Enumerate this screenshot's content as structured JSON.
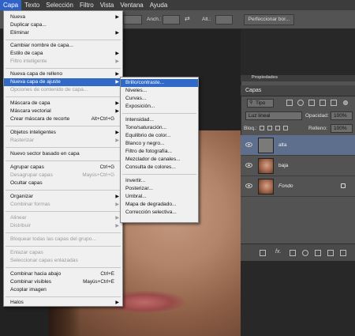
{
  "menubar": {
    "items": [
      "Capa",
      "Texto",
      "Selección",
      "Filtro",
      "Vista",
      "Ventana",
      "Ayuda"
    ],
    "active_index": 0
  },
  "options_bar": {
    "width_label": "Anch.:",
    "height_label": "Alt.:",
    "refine_button": "Perfeccionar bor..."
  },
  "capa_menu": {
    "items": [
      {
        "label": "Nueva",
        "shortcut": "",
        "submenu": true,
        "disabled": false
      },
      {
        "label": "Duplicar capa...",
        "shortcut": "",
        "submenu": false,
        "disabled": false
      },
      {
        "label": "Eliminar",
        "shortcut": "",
        "submenu": true,
        "disabled": false
      },
      {
        "label": "Cambiar nombre de capa...",
        "shortcut": "",
        "submenu": false,
        "disabled": false
      },
      {
        "label": "Estilo de capa",
        "shortcut": "",
        "submenu": true,
        "disabled": false
      },
      {
        "label": "Filtro inteligente",
        "shortcut": "",
        "submenu": true,
        "disabled": true
      },
      {
        "label": "Nueva capa de relleno",
        "shortcut": "",
        "submenu": true,
        "disabled": false
      },
      {
        "label": "Nueva capa de ajuste",
        "shortcut": "",
        "submenu": true,
        "disabled": false,
        "highlighted": true
      },
      {
        "label": "Opciones de contenido de capa...",
        "shortcut": "",
        "submenu": false,
        "disabled": true
      },
      {
        "label": "Máscara de capa",
        "shortcut": "",
        "submenu": true,
        "disabled": false
      },
      {
        "label": "Máscara vectorial",
        "shortcut": "",
        "submenu": true,
        "disabled": false
      },
      {
        "label": "Crear máscara de recorte",
        "shortcut": "Alt+Ctrl+G",
        "submenu": false,
        "disabled": false
      },
      {
        "label": "Objetos inteligentes",
        "shortcut": "",
        "submenu": true,
        "disabled": false
      },
      {
        "label": "Rasterizar",
        "shortcut": "",
        "submenu": true,
        "disabled": true
      },
      {
        "label": "Nuevo sector basado en capa",
        "shortcut": "",
        "submenu": false,
        "disabled": false
      },
      {
        "label": "Agrupar capas",
        "shortcut": "Ctrl+G",
        "submenu": false,
        "disabled": false
      },
      {
        "label": "Desagrupar capas",
        "shortcut": "Mayús+Ctrl+G",
        "submenu": false,
        "disabled": true
      },
      {
        "label": "Ocultar capas",
        "shortcut": "",
        "submenu": false,
        "disabled": false
      },
      {
        "label": "Organizar",
        "shortcut": "",
        "submenu": true,
        "disabled": false
      },
      {
        "label": "Combinar formas",
        "shortcut": "",
        "submenu": true,
        "disabled": true
      },
      {
        "label": "Alinear",
        "shortcut": "",
        "submenu": true,
        "disabled": true
      },
      {
        "label": "Distribuir",
        "shortcut": "",
        "submenu": true,
        "disabled": true
      },
      {
        "label": "Bloquear todas las capas del grupo...",
        "shortcut": "",
        "submenu": false,
        "disabled": true
      },
      {
        "label": "Enlazar capas",
        "shortcut": "",
        "submenu": false,
        "disabled": true
      },
      {
        "label": "Seleccionar capas enlazadas",
        "shortcut": "",
        "submenu": false,
        "disabled": true
      },
      {
        "label": "Combinar hacia abajo",
        "shortcut": "Ctrl+E",
        "submenu": false,
        "disabled": false
      },
      {
        "label": "Combinar visibles",
        "shortcut": "Mayús+Ctrl+E",
        "submenu": false,
        "disabled": false
      },
      {
        "label": "Acoplar imagen",
        "shortcut": "",
        "submenu": false,
        "disabled": false
      },
      {
        "label": "Halos",
        "shortcut": "",
        "submenu": true,
        "disabled": false
      }
    ]
  },
  "adjustment_submenu": {
    "items": [
      "Brillo/contraste...",
      "Niveles...",
      "Curvas...",
      "Exposición...",
      "Intensidad...",
      "Tono/saturación...",
      "Equilibrio de color...",
      "Blanco y negro...",
      "Filtro de fotografía...",
      "Mezclador de canales...",
      "Consulta de colores...",
      "Invertir...",
      "Posterizar...",
      "Umbral...",
      "Mapa de degradado...",
      "Corrección selectiva..."
    ],
    "highlighted_index": 0
  },
  "layers_panel": {
    "tab_strip_label": "Propiedades",
    "title": "Capas",
    "filter_label": "Tipo",
    "blend_mode": "Luz lineal",
    "opacity_label": "Opacidad:",
    "opacity_value": "100%",
    "lock_label": "Bloq.:",
    "fill_label": "Relleno:",
    "fill_value": "100%",
    "fx_label": "fx.",
    "layers": [
      {
        "name": "alta",
        "thumb": "gray",
        "selected": true,
        "locked": false,
        "italic": false
      },
      {
        "name": "baja",
        "thumb": "face",
        "selected": false,
        "locked": false,
        "italic": false
      },
      {
        "name": "Fondo",
        "thumb": "face",
        "selected": false,
        "locked": true,
        "italic": true
      }
    ]
  }
}
